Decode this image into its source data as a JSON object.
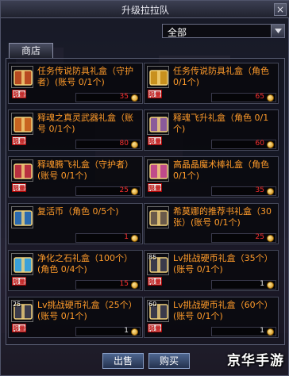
{
  "window": {
    "title": "升级拉拉队",
    "close_label": "×"
  },
  "filter": {
    "selected": "全部"
  },
  "tabs": [
    {
      "label": "商店"
    }
  ],
  "items": [
    {
      "name": "任务传说防具礼盒（守护者）(账号 0/1个)",
      "price": "35",
      "limited": true,
      "count": "",
      "icon_color": "#b84a20"
    },
    {
      "name": "任务传说防具礼盒（角色 0/1个)",
      "price": "65",
      "limited": true,
      "count": "",
      "icon_color": "#c8901e"
    },
    {
      "name": "释魂之真灵武器礼盒（账号 0/1个)",
      "price": "80",
      "limited": true,
      "count": "",
      "icon_color": "#c86420"
    },
    {
      "name": "释魂飞升礼盒（角色 0/1个)",
      "price": "60",
      "limited": true,
      "count": "",
      "icon_color": "#8a5a9a"
    },
    {
      "name": "释魂腾飞礼盒（守护者）(账号 0/1个)",
      "price": "25",
      "limited": true,
      "count": "",
      "icon_color": "#b83040"
    },
    {
      "name": "高晶晶魔术棒礼盒（角色 0/1个)",
      "price": "35",
      "limited": true,
      "count": "",
      "icon_color": "#c04a8a"
    },
    {
      "name": "复活币（角色 0/5个)",
      "price": "1",
      "limited": false,
      "count": "",
      "icon_color": "#2a6ab0"
    },
    {
      "name": "希莫娜的推荐书礼盒（30张）(账号 0/1个)",
      "price": "25",
      "limited": false,
      "count": "",
      "icon_color": "#6a5a4a"
    },
    {
      "name": "净化之石礼盒（100个）(角色 0/4个)",
      "price": "15",
      "limited": true,
      "count": "",
      "icon_color": "#3aa0d8"
    },
    {
      "name": "Lv挑战硬币礼盒（35个）(账号 0/1个)",
      "price": "1",
      "limited": true,
      "count": "85",
      "icon_color": "#3a3a4a"
    },
    {
      "name": "Lv挑战硬币礼盒（25个）(账号 0/1个)",
      "price": "1",
      "limited": true,
      "count": "25",
      "icon_color": "#3a3a4a"
    },
    {
      "name": "Lv挑战硬币礼盒（60个）(账号 0/1个)",
      "price": "1",
      "limited": true,
      "count": "60",
      "icon_color": "#3a3a4a"
    }
  ],
  "limited_label": "限量",
  "buttons": {
    "sell": "出售",
    "buy": "购买"
  },
  "watermark": "京华手游"
}
